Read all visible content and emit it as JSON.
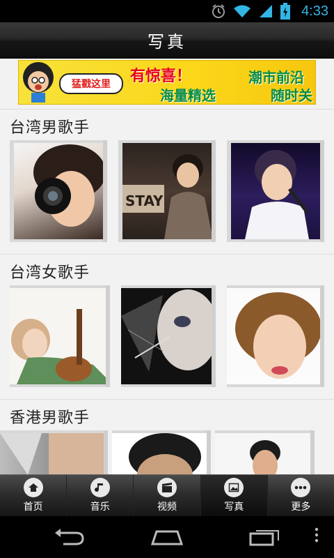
{
  "status_bar": {
    "time": "4:33",
    "icons": [
      "alarm-icon",
      "wifi-icon",
      "signal-icon",
      "battery-icon"
    ]
  },
  "title_bar": {
    "title": "写真"
  },
  "banner": {
    "bubble_text": "猛戳这里",
    "line1": "有惊喜！",
    "line2": "海量精选",
    "line3": "潮市前沿",
    "line4": "随时关注"
  },
  "sections": [
    {
      "label": "台湾男歌手"
    },
    {
      "label": "台湾女歌手"
    },
    {
      "label": "香港男歌手"
    }
  ],
  "bottom_nav": {
    "items": [
      {
        "label": "首页",
        "icon": "home-icon"
      },
      {
        "label": "音乐",
        "icon": "music-note-icon"
      },
      {
        "label": "视频",
        "icon": "clapperboard-icon"
      },
      {
        "label": "写真",
        "icon": "photo-icon"
      },
      {
        "label": "更多",
        "icon": "more-icon"
      }
    ],
    "active_index": 3
  },
  "system_nav": {
    "buttons": [
      "back-icon",
      "home-icon",
      "recent-apps-icon",
      "overflow-menu-icon"
    ]
  },
  "colors": {
    "time": "#33b5e5",
    "banner": "#fbd619",
    "nav_bg": "#2b2b2b"
  }
}
